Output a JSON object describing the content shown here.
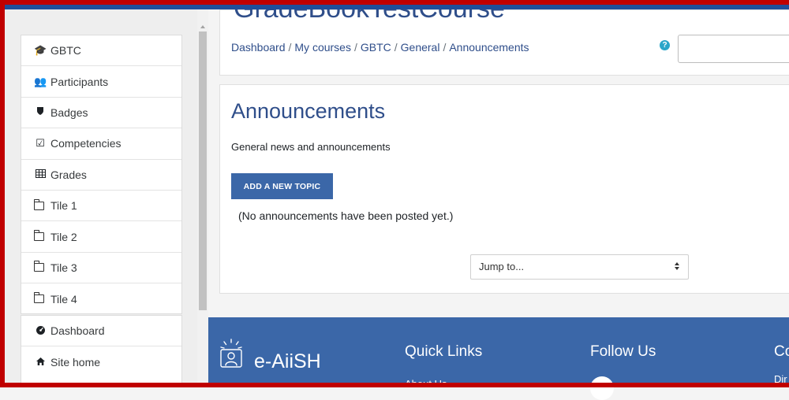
{
  "course": {
    "title": "GradeBookTestCourse"
  },
  "sidebar": {
    "course_nav": [
      {
        "icon": "graduation-cap-icon",
        "label": "GBTC"
      },
      {
        "icon": "users-icon",
        "label": "Participants"
      },
      {
        "icon": "shield-icon",
        "label": "Badges"
      },
      {
        "icon": "checkbox-icon",
        "label": "Competencies"
      },
      {
        "icon": "table-icon",
        "label": "Grades"
      },
      {
        "icon": "folder-icon",
        "label": "Tile 1"
      },
      {
        "icon": "folder-icon",
        "label": "Tile 2"
      },
      {
        "icon": "folder-icon",
        "label": "Tile 3"
      },
      {
        "icon": "folder-icon",
        "label": "Tile 4"
      }
    ],
    "site_nav": [
      {
        "icon": "tachometer-icon",
        "label": "Dashboard"
      },
      {
        "icon": "home-icon",
        "label": "Site home"
      }
    ]
  },
  "breadcrumb": {
    "items": [
      "Dashboard",
      "My courses",
      "GBTC",
      "General",
      "Announcements"
    ],
    "separator": "/"
  },
  "help": {
    "glyph": "?"
  },
  "main": {
    "heading": "Announcements",
    "description": "General news and announcements",
    "add_topic_label": "ADD A NEW TOPIC",
    "empty_message": "(No announcements have been posted yet.)",
    "jump_to": {
      "selected": "Jump to..."
    }
  },
  "footer": {
    "logo_text": "e-AiiSH",
    "quick_links_heading": "Quick Links",
    "follow_us_heading": "Follow Us",
    "partial_heading": "Co",
    "quick_links": [
      "About Us"
    ],
    "partial_text": "Dir"
  },
  "colors": {
    "brand_blue": "#3b67a8",
    "heading_blue": "#2f4e8a",
    "frame_red": "#c00000",
    "help_cyan": "#2aa6c9"
  }
}
